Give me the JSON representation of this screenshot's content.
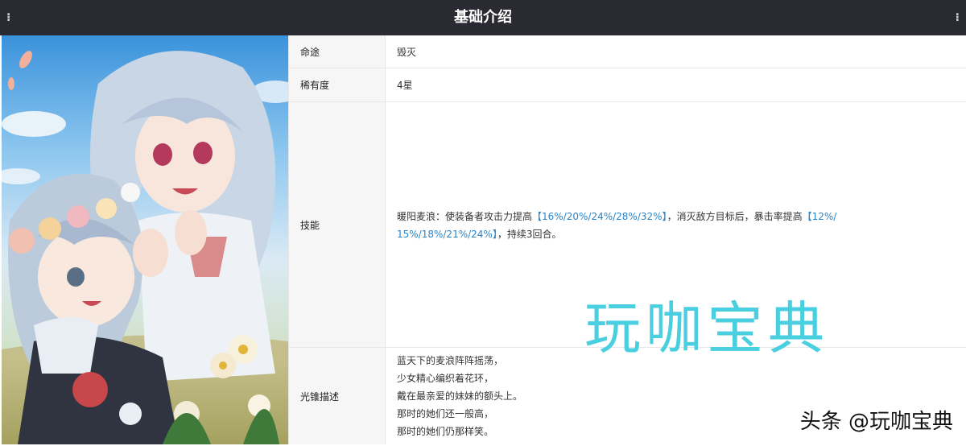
{
  "header": {
    "title": "基础介绍",
    "left_mark": "⁝",
    "right_mark": "⁝"
  },
  "table": {
    "rows": [
      {
        "label": "命途",
        "value": "毁灭"
      },
      {
        "label": "稀有度",
        "value": "4星"
      }
    ],
    "skill": {
      "label": "技能",
      "prefix": "暖阳麦浪：使装备者攻击力提高",
      "highlight1": "【16%/20%/24%/28%/32%】",
      "middle": "，消灭敌方目标后，暴击率提高",
      "highlight2a": "【12%/",
      "highlight2b": "15%/18%/21%/24%】",
      "suffix": "，持续3回合。"
    },
    "description": {
      "label": "光锥描述",
      "lines": [
        "蓝天下的麦浪阵阵摇荡，",
        "少女精心编织着花环，",
        "戴在最亲爱的妹妹的额头上。",
        "那时的她们还一般高，",
        "那时的她们仍那样笑。"
      ]
    }
  },
  "watermark": "玩咖宝典",
  "credit": "头条 @玩咖宝典",
  "colors": {
    "header_bg": "#2a2a33",
    "highlight": "#2a84c9",
    "watermark": "#49cfe0"
  }
}
